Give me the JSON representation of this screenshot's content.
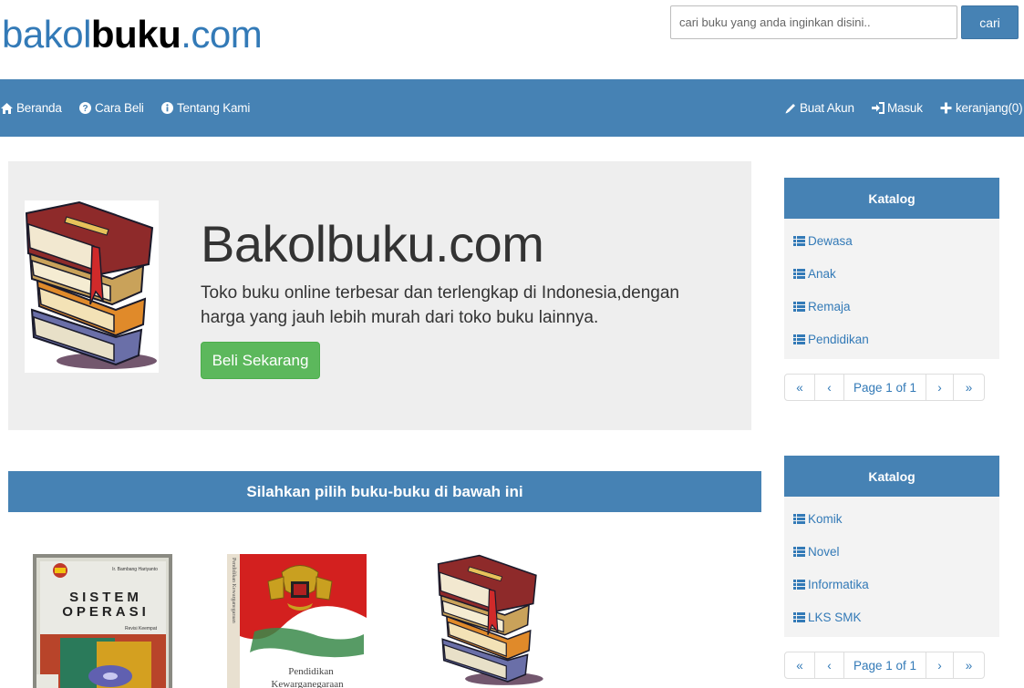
{
  "header": {
    "logo_part1": "bakol",
    "logo_part2": "buku",
    "logo_part3": ".com",
    "search_placeholder": "cari buku yang anda inginkan disini..",
    "search_button": "cari"
  },
  "nav": {
    "left": [
      {
        "label": "Beranda",
        "icon": "home-icon"
      },
      {
        "label": "Cara Beli",
        "icon": "question-circle-icon"
      },
      {
        "label": "Tentang Kami",
        "icon": "info-circle-icon"
      }
    ],
    "right": [
      {
        "label": "Buat Akun",
        "icon": "pencil-icon"
      },
      {
        "label": "Masuk",
        "icon": "login-icon"
      },
      {
        "label": "keranjang(0)",
        "icon": "plus-icon"
      }
    ]
  },
  "hero": {
    "title": "Bakolbuku.com",
    "text": "Toko buku online terbesar dan terlengkap di Indonesia,dengan harga yang jauh lebih murah dari toko buku lainnya.",
    "button": "Beli Sekarang"
  },
  "section": {
    "title": "Silahkan pilih buku-buku di bawah ini"
  },
  "products": {
    "sistem_operasi": {
      "author": "Ir. Bambang Hariyanto",
      "title_line1": "SISTEM",
      "title_line2": "OPERASI",
      "subtitle": "Revisi Keempat"
    },
    "pkn": {
      "spine": "Pendidikan Kewarganegaraan",
      "title_line1": "Pendidikan",
      "title_line2": "Kewarganegaraan"
    }
  },
  "sidebar": {
    "panel1": {
      "title": "Katalog",
      "items": [
        "Dewasa",
        "Anak",
        "Remaja",
        "Pendidikan"
      ],
      "pager": {
        "first": "«",
        "prev": "‹",
        "page": "Page 1 of 1",
        "next": "›",
        "last": "»"
      }
    },
    "panel2": {
      "title": "Katalog",
      "items": [
        "Komik",
        "Novel",
        "Informatika",
        "LKS SMK"
      ],
      "pager": {
        "first": "«",
        "prev": "‹",
        "page": "Page 1 of 1",
        "next": "›",
        "last": "»"
      }
    }
  },
  "colors": {
    "brand_blue": "#4682b4",
    "link_blue": "#337ab7",
    "success_green": "#5cb85c",
    "hero_bg": "#eeeeee"
  }
}
